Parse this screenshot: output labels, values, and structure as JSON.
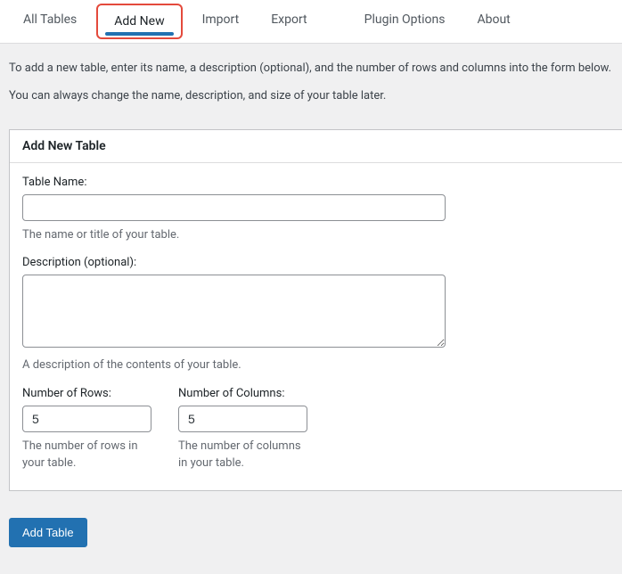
{
  "tabs": {
    "all_tables": "All Tables",
    "add_new": "Add New",
    "import": "Import",
    "export": "Export",
    "plugin_options": "Plugin Options",
    "about": "About"
  },
  "intro": {
    "line1": "To add a new table, enter its name, a description (optional), and the number of rows and columns into the form below.",
    "line2": "You can always change the name, description, and size of your table later."
  },
  "panel": {
    "title": "Add New Table",
    "fields": {
      "name": {
        "label": "Table Name:",
        "value": "",
        "helper": "The name or title of your table."
      },
      "description": {
        "label": "Description (optional):",
        "value": "",
        "helper": "A description of the contents of your table."
      },
      "rows": {
        "label": "Number of Rows:",
        "value": "5",
        "helper": "The number of rows in your table."
      },
      "columns": {
        "label": "Number of Columns:",
        "value": "5",
        "helper": "The number of columns in your table."
      }
    }
  },
  "submit": {
    "label": "Add Table"
  }
}
